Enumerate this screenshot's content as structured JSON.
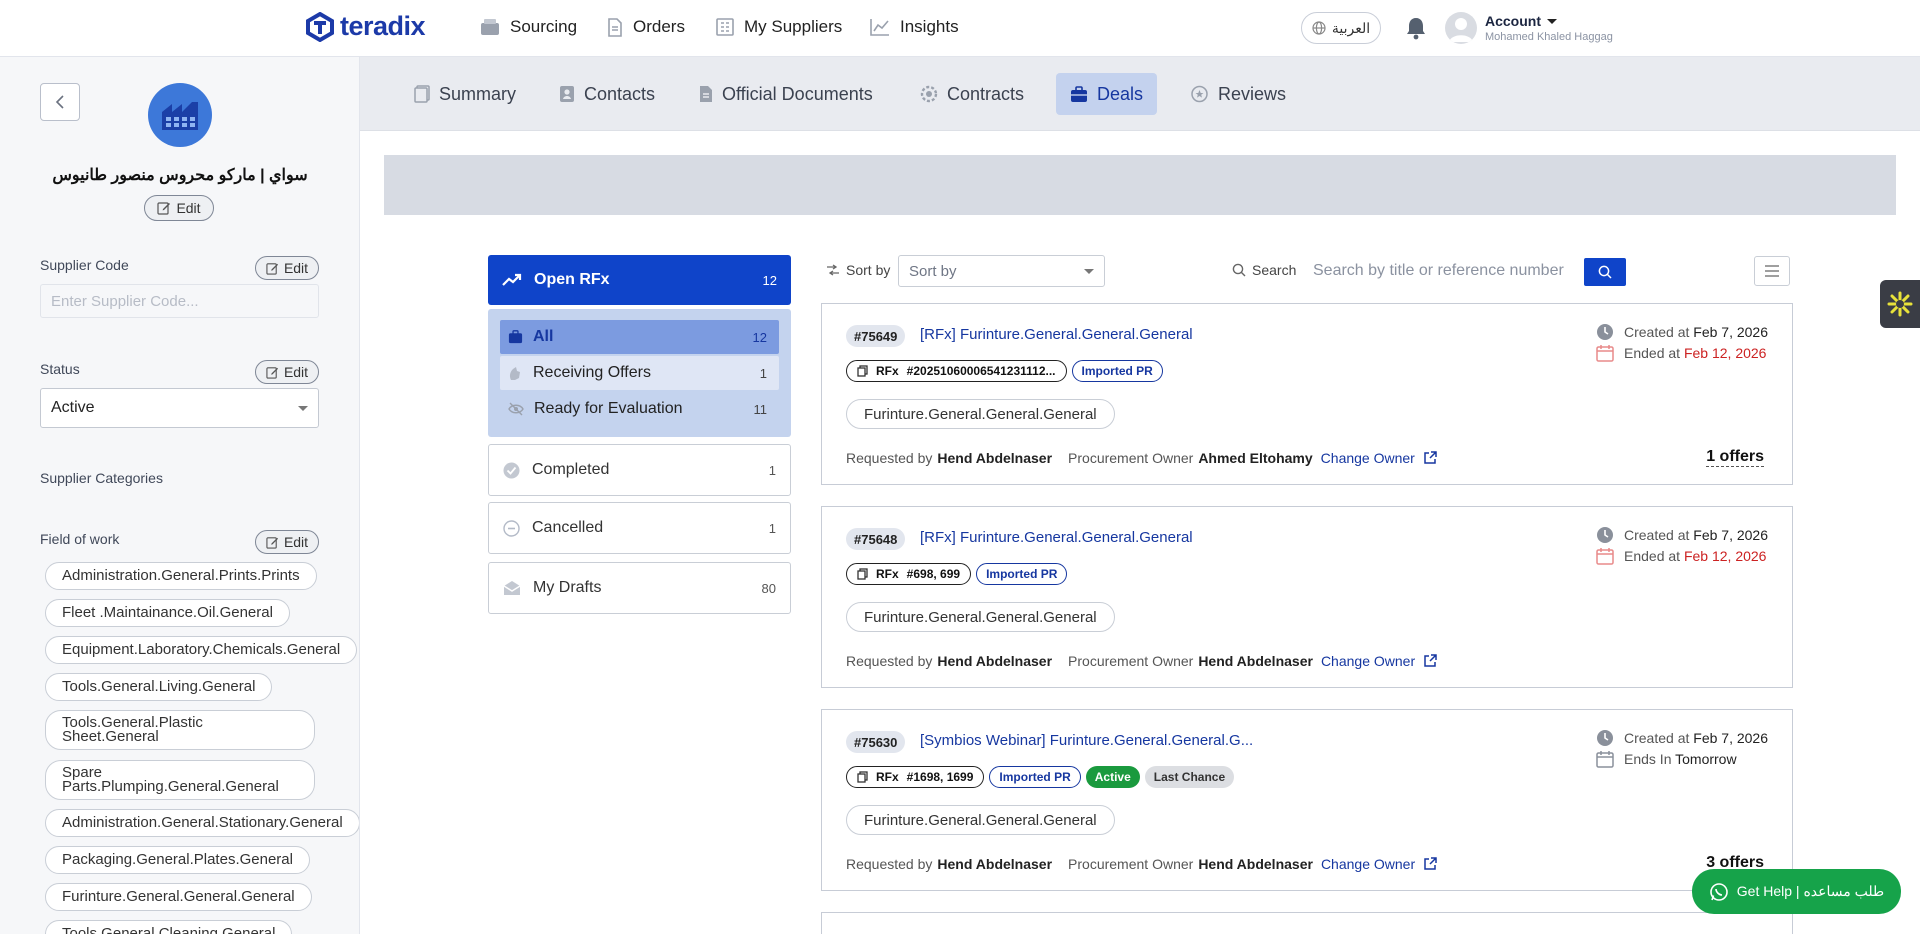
{
  "nav": {
    "logo": "teradix",
    "items": [
      {
        "label": "Sourcing",
        "icon": "inbox-icon"
      },
      {
        "label": "Orders",
        "icon": "document-icon"
      },
      {
        "label": "My Suppliers",
        "icon": "building-icon"
      },
      {
        "label": "Insights",
        "icon": "chart-line-icon"
      }
    ],
    "lang": "العربية",
    "account_label": "Account",
    "account_name": "Mohamed Khaled Haggag"
  },
  "sidebar": {
    "supplier_name": "سواي | ماركو محروس منصور طانيوس",
    "edit_label": "Edit",
    "supplier_code_label": "Supplier Code",
    "supplier_code_placeholder": "Enter Supplier Code...",
    "status_label": "Status",
    "status_value": "Active",
    "categories_label": "Supplier Categories",
    "field_of_work_label": "Field of work",
    "tags": [
      "Administration.General.Prints.Prints",
      "Fleet .Maintainance.Oil.General",
      "Equipment.Laboratory.Chemicals.General",
      "Tools.General.Living.General",
      "Tools.General.Plastic Sheet.General",
      "Spare Parts.Plumping.General.General",
      "Administration.General.Stationary.General",
      "Packaging.General.Plates.General",
      "Furinture.General.General.General",
      "Tools.General.Cleaning.General"
    ]
  },
  "tabs": [
    {
      "label": "Summary",
      "icon": "summary-icon"
    },
    {
      "label": "Contacts",
      "icon": "contacts-icon"
    },
    {
      "label": "Official Documents",
      "icon": "document-icon"
    },
    {
      "label": "Contracts",
      "icon": "gear-icon"
    },
    {
      "label": "Deals",
      "icon": "briefcase-icon",
      "active": true
    },
    {
      "label": "Reviews",
      "icon": "reviews-icon"
    }
  ],
  "filters": {
    "open_rfx": {
      "label": "Open RFx",
      "count": "12"
    },
    "sub": [
      {
        "label": "All",
        "count": "12",
        "active": true
      },
      {
        "label": "Receiving Offers",
        "count": "1"
      },
      {
        "label": "Ready for Evaluation",
        "count": "11"
      }
    ],
    "completed": {
      "label": "Completed",
      "count": "1"
    },
    "cancelled": {
      "label": "Cancelled",
      "count": "1"
    },
    "drafts": {
      "label": "My Drafts",
      "count": "80"
    }
  },
  "toolbar": {
    "sort_label": "Sort by",
    "sort_placeholder": "Sort by",
    "search_label": "Search",
    "search_placeholder": "Search by title or reference number"
  },
  "cards": [
    {
      "id": "#75649",
      "title": "[RFx] Furinture.General.General.General",
      "rfx_label": "RFx",
      "rfx_ref": "#20251060006541231112...",
      "badges": [
        "Imported PR"
      ],
      "category": "Furinture.General.General.General",
      "requested_by_label": "Requested by",
      "requested_by": "Hend Abdelnaser",
      "owner_label": "Procurement Owner",
      "owner": "Ahmed Eltohamy",
      "change_owner": "Change Owner",
      "created_label": "Created at",
      "created": "Feb 7, 2026",
      "end_label": "Ended at",
      "end": "Feb 12, 2026",
      "offers": "1 offers"
    },
    {
      "id": "#75648",
      "title": "[RFx] Furinture.General.General.General",
      "rfx_label": "RFx",
      "rfx_ref": "#698, 699",
      "badges": [
        "Imported PR"
      ],
      "category": "Furinture.General.General.General",
      "requested_by_label": "Requested by",
      "requested_by": "Hend Abdelnaser",
      "owner_label": "Procurement Owner",
      "owner": "Hend Abdelnaser",
      "change_owner": "Change Owner",
      "created_label": "Created at",
      "created": "Feb 7, 2026",
      "end_label": "Ended at",
      "end": "Feb 12, 2026",
      "offers": ""
    },
    {
      "id": "#75630",
      "title": "[Symbios Webinar] Furinture.General.General.G...",
      "rfx_label": "RFx",
      "rfx_ref": "#1698, 1699",
      "badges": [
        "Imported PR",
        "Active",
        "Last Chance"
      ],
      "category": "Furinture.General.General.General",
      "requested_by_label": "Requested by",
      "requested_by": "Hend Abdelnaser",
      "owner_label": "Procurement Owner",
      "owner": "Hend Abdelnaser",
      "change_owner": "Change Owner",
      "created_label": "Created at",
      "created": "Feb 7, 2026",
      "end_label": "Ends In",
      "end": "Tomorrow",
      "offers": "3 offers"
    }
  ],
  "help": {
    "label": "Get Help | طلب مساعده"
  },
  "colors": {
    "brand": "#1c3aa8",
    "primary": "#0f44c9",
    "danger": "#cc2222",
    "success": "#16a34a"
  }
}
